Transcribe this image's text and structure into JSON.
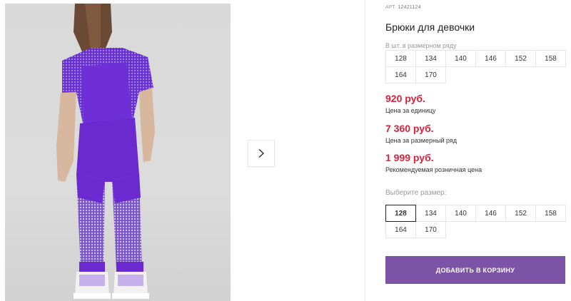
{
  "product": {
    "article_label": "АРТ.",
    "article_number": "12421124",
    "title": "Брюки для девочки"
  },
  "size_range": {
    "label": "В шт. в размерном ряду",
    "sizes": [
      "128",
      "134",
      "140",
      "146",
      "152",
      "158",
      "164",
      "170"
    ]
  },
  "prices": {
    "unit_price": "920 руб.",
    "unit_caption": "Цена за единицу",
    "range_price": "7 360 руб.",
    "range_caption": "Цена за размерный ряд",
    "retail_price": "1 999 руб.",
    "retail_caption": "Рекомендуемая розничная цена",
    "price_color": "#d8213b"
  },
  "size_select": {
    "label": "Выберите размер:",
    "sizes": [
      "128",
      "134",
      "140",
      "146",
      "152",
      "158",
      "164",
      "170"
    ],
    "selected": "128"
  },
  "cart": {
    "button_label": "ДОБАВИТЬ В КОРЗИНУ",
    "button_color": "#7d53a6"
  },
  "gallery": {
    "next_icon": "chevron-right-icon",
    "image_subject": "product-photo"
  }
}
